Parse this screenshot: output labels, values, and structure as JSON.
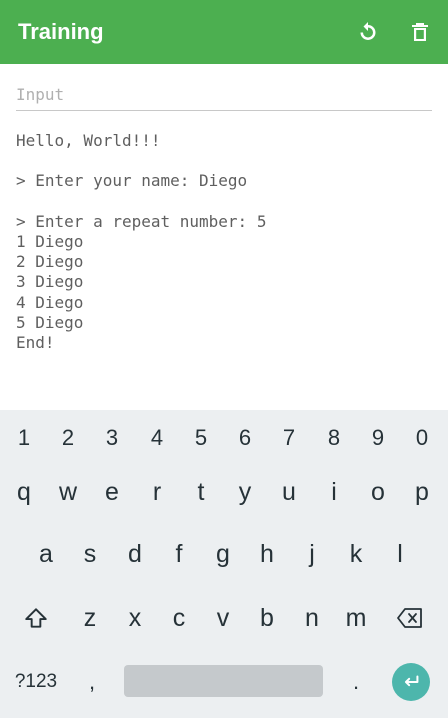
{
  "appbar": {
    "title": "Training",
    "actions": [
      "refresh-icon",
      "trash-icon"
    ],
    "color": "#4caf50"
  },
  "input": {
    "placeholder": "Input",
    "value": ""
  },
  "console": {
    "lines": [
      "Hello, World!!!",
      "",
      "> Enter your name: Diego",
      "",
      "> Enter a repeat number: 5",
      "1 Diego",
      "2 Diego",
      "3 Diego",
      "4 Diego",
      "5 Diego",
      "End!"
    ]
  },
  "keyboard": {
    "number_row": [
      "1",
      "2",
      "3",
      "4",
      "5",
      "6",
      "7",
      "8",
      "9",
      "0"
    ],
    "row1": [
      "q",
      "w",
      "e",
      "r",
      "t",
      "y",
      "u",
      "i",
      "o",
      "p"
    ],
    "row2": [
      "a",
      "s",
      "d",
      "f",
      "g",
      "h",
      "j",
      "k",
      "l"
    ],
    "row3": [
      "z",
      "x",
      "c",
      "v",
      "b",
      "n",
      "m"
    ],
    "symbols_label": "?123",
    "comma": ",",
    "period": ".",
    "shift_icon": "shift-icon",
    "backspace_icon": "backspace-icon",
    "enter_icon": "enter-icon",
    "enter_color": "#4db6ac"
  }
}
